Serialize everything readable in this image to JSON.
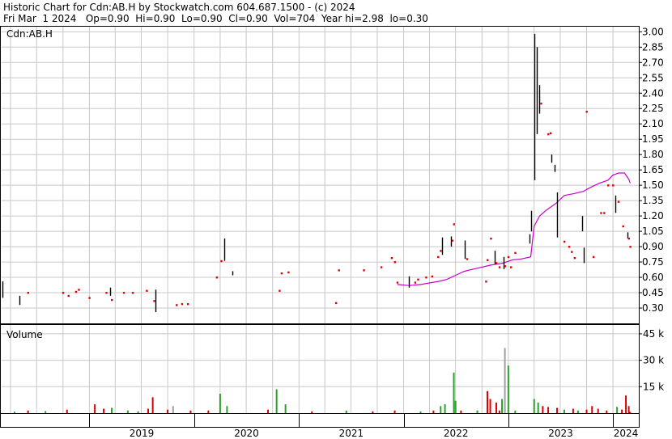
{
  "header": {
    "line1": "Historic Chart for Cdn:AB.H by Stockwatch.com 604.687.1500 - (c) 2024",
    "line2": "Fri Mar  1 2024   Op=0.90  Hi=0.90  Lo=0.90  Cl=0.90  Vol=704  Year hi=2.98  lo=0.30"
  },
  "colors": {
    "background": "#ffffff",
    "grid": "#c8c8c8",
    "price_bar": "#000000",
    "price_dot": "#e00000",
    "moving_average": "#cc00cc",
    "volume_up": "#2ca02c",
    "volume_down": "#dd0000",
    "volume_neutral": "#a0a0a0"
  },
  "chart_data": {
    "type": "line",
    "title": "Cdn:AB.H",
    "price_axis": {
      "ylim": [
        0.15,
        3.05
      ],
      "ticks": [
        "3.00",
        "2.85",
        "2.70",
        "2.55",
        "2.40",
        "2.25",
        "2.10",
        "1.95",
        "1.80",
        "1.65",
        "1.50",
        "1.35",
        "1.20",
        "1.05",
        "0.90",
        "0.75",
        "0.60",
        "0.45",
        "0.30"
      ]
    },
    "volume_axis": {
      "label": "Volume",
      "ylim": [
        0,
        50000
      ],
      "ticks": [
        {
          "v": 45000,
          "label": "45 k"
        },
        {
          "v": 30000,
          "label": "30 k"
        },
        {
          "v": 15000,
          "label": "15 k"
        }
      ]
    },
    "years": [
      "2019",
      "2020",
      "2021",
      "2022",
      "2023",
      "2024"
    ],
    "year_starts": [
      "2019-01-01",
      "2020-01-01",
      "2021-01-01",
      "2022-01-01",
      "2023-01-01",
      "2024-01-01"
    ],
    "x_range": [
      "2018-03-01",
      "2024-03-31"
    ],
    "grid": true,
    "price_bars": [
      {
        "date": "2018-03-05",
        "hi": 0.56,
        "lo": 0.4
      },
      {
        "date": "2018-05-01",
        "hi": 0.42,
        "lo": 0.33
      },
      {
        "date": "2019-03-15",
        "hi": 0.5,
        "lo": 0.42
      },
      {
        "date": "2019-08-20",
        "hi": 0.48,
        "lo": 0.26
      },
      {
        "date": "2020-04-15",
        "hi": 0.98,
        "lo": 0.76
      },
      {
        "date": "2020-05-15",
        "hi": 0.66,
        "lo": 0.62
      },
      {
        "date": "2022-01-20",
        "hi": 0.61,
        "lo": 0.5
      },
      {
        "date": "2022-05-15",
        "hi": 0.99,
        "lo": 0.82
      },
      {
        "date": "2022-06-15",
        "hi": 1.0,
        "lo": 0.9
      },
      {
        "date": "2022-08-01",
        "hi": 0.96,
        "lo": 0.78
      },
      {
        "date": "2022-11-15",
        "hi": 0.86,
        "lo": 0.73
      },
      {
        "date": "2022-12-15",
        "hi": 0.8,
        "lo": 0.68
      },
      {
        "date": "2023-03-15",
        "hi": 1.02,
        "lo": 0.93
      },
      {
        "date": "2023-03-22",
        "hi": 1.25,
        "lo": 1.05
      },
      {
        "date": "2023-04-01",
        "hi": 2.98,
        "lo": 1.55
      },
      {
        "date": "2023-04-10",
        "hi": 2.85,
        "lo": 2.0
      },
      {
        "date": "2023-04-20",
        "hi": 2.48,
        "lo": 2.2
      },
      {
        "date": "2023-06-01",
        "hi": 1.8,
        "lo": 1.72
      },
      {
        "date": "2023-06-10",
        "hi": 1.7,
        "lo": 1.63
      },
      {
        "date": "2023-06-20",
        "hi": 1.43,
        "lo": 0.99
      },
      {
        "date": "2023-09-15",
        "hi": 1.2,
        "lo": 1.05
      },
      {
        "date": "2023-09-20",
        "hi": 0.89,
        "lo": 0.74
      },
      {
        "date": "2024-01-10",
        "hi": 1.4,
        "lo": 1.23
      },
      {
        "date": "2024-02-20",
        "hi": 1.04,
        "lo": 0.98
      }
    ],
    "price_dots": [
      {
        "date": "2018-06-01",
        "v": 0.45
      },
      {
        "date": "2018-10-01",
        "v": 0.45
      },
      {
        "date": "2018-10-20",
        "v": 0.42
      },
      {
        "date": "2018-11-15",
        "v": 0.46
      },
      {
        "date": "2018-11-25",
        "v": 0.48
      },
      {
        "date": "2019-01-01",
        "v": 0.4
      },
      {
        "date": "2019-03-01",
        "v": 0.45
      },
      {
        "date": "2019-03-20",
        "v": 0.38
      },
      {
        "date": "2019-05-01",
        "v": 0.45
      },
      {
        "date": "2019-06-01",
        "v": 0.45
      },
      {
        "date": "2019-07-20",
        "v": 0.47
      },
      {
        "date": "2019-08-15",
        "v": 0.37
      },
      {
        "date": "2019-11-01",
        "v": 0.33
      },
      {
        "date": "2019-11-20",
        "v": 0.34
      },
      {
        "date": "2019-12-10",
        "v": 0.34
      },
      {
        "date": "2020-03-20",
        "v": 0.6
      },
      {
        "date": "2020-04-05",
        "v": 0.76
      },
      {
        "date": "2020-10-25",
        "v": 0.47
      },
      {
        "date": "2020-11-01",
        "v": 0.64
      },
      {
        "date": "2020-11-25",
        "v": 0.65
      },
      {
        "date": "2021-05-10",
        "v": 0.35
      },
      {
        "date": "2021-05-20",
        "v": 0.67
      },
      {
        "date": "2021-08-15",
        "v": 0.67
      },
      {
        "date": "2021-10-15",
        "v": 0.7
      },
      {
        "date": "2021-11-20",
        "v": 0.79
      },
      {
        "date": "2021-12-01",
        "v": 0.75
      },
      {
        "date": "2021-12-10",
        "v": 0.55
      },
      {
        "date": "2022-02-10",
        "v": 0.55
      },
      {
        "date": "2022-02-20",
        "v": 0.58
      },
      {
        "date": "2022-03-20",
        "v": 0.6
      },
      {
        "date": "2022-04-10",
        "v": 0.61
      },
      {
        "date": "2022-05-01",
        "v": 0.8
      },
      {
        "date": "2022-05-10",
        "v": 0.86
      },
      {
        "date": "2022-06-20",
        "v": 0.96
      },
      {
        "date": "2022-06-25",
        "v": 1.12
      },
      {
        "date": "2022-08-10",
        "v": 0.78
      },
      {
        "date": "2022-10-15",
        "v": 0.56
      },
      {
        "date": "2022-10-20",
        "v": 0.77
      },
      {
        "date": "2022-11-01",
        "v": 0.98
      },
      {
        "date": "2022-11-20",
        "v": 0.74
      },
      {
        "date": "2022-12-01",
        "v": 0.7
      },
      {
        "date": "2022-12-20",
        "v": 0.71
      },
      {
        "date": "2023-01-01",
        "v": 0.8
      },
      {
        "date": "2023-01-10",
        "v": 0.7
      },
      {
        "date": "2023-01-25",
        "v": 0.84
      },
      {
        "date": "2023-04-25",
        "v": 2.3
      },
      {
        "date": "2023-05-20",
        "v": 2.0
      },
      {
        "date": "2023-05-28",
        "v": 2.01
      },
      {
        "date": "2023-07-15",
        "v": 0.95
      },
      {
        "date": "2023-08-01",
        "v": 0.9
      },
      {
        "date": "2023-08-10",
        "v": 0.85
      },
      {
        "date": "2023-08-20",
        "v": 0.79
      },
      {
        "date": "2023-10-01",
        "v": 2.22
      },
      {
        "date": "2023-10-25",
        "v": 0.8
      },
      {
        "date": "2023-11-20",
        "v": 1.23
      },
      {
        "date": "2023-12-01",
        "v": 1.23
      },
      {
        "date": "2023-12-15",
        "v": 1.5
      },
      {
        "date": "2024-01-01",
        "v": 1.5
      },
      {
        "date": "2024-01-20",
        "v": 1.34
      },
      {
        "date": "2024-02-05",
        "v": 1.1
      },
      {
        "date": "2024-02-25",
        "v": 0.98
      },
      {
        "date": "2024-03-01",
        "v": 0.9
      }
    ],
    "moving_average": [
      {
        "date": "2021-12-10",
        "v": 0.53
      },
      {
        "date": "2022-01-20",
        "v": 0.52
      },
      {
        "date": "2022-03-01",
        "v": 0.53
      },
      {
        "date": "2022-05-01",
        "v": 0.56
      },
      {
        "date": "2022-06-01",
        "v": 0.58
      },
      {
        "date": "2022-07-01",
        "v": 0.62
      },
      {
        "date": "2022-08-01",
        "v": 0.66
      },
      {
        "date": "2022-09-15",
        "v": 0.69
      },
      {
        "date": "2022-11-01",
        "v": 0.72
      },
      {
        "date": "2022-12-15",
        "v": 0.74
      },
      {
        "date": "2023-01-15",
        "v": 0.77
      },
      {
        "date": "2023-02-15",
        "v": 0.78
      },
      {
        "date": "2023-03-20",
        "v": 0.8
      },
      {
        "date": "2023-04-01",
        "v": 1.1
      },
      {
        "date": "2023-04-20",
        "v": 1.2
      },
      {
        "date": "2023-05-15",
        "v": 1.26
      },
      {
        "date": "2023-06-15",
        "v": 1.32
      },
      {
        "date": "2023-07-15",
        "v": 1.4
      },
      {
        "date": "2023-08-20",
        "v": 1.42
      },
      {
        "date": "2023-09-20",
        "v": 1.44
      },
      {
        "date": "2023-10-15",
        "v": 1.48
      },
      {
        "date": "2023-11-15",
        "v": 1.52
      },
      {
        "date": "2023-12-15",
        "v": 1.55
      },
      {
        "date": "2024-01-01",
        "v": 1.6
      },
      {
        "date": "2024-01-20",
        "v": 1.62
      },
      {
        "date": "2024-02-10",
        "v": 1.62
      },
      {
        "date": "2024-02-25",
        "v": 1.56
      },
      {
        "date": "2024-03-01",
        "v": 1.52
      }
    ],
    "volume_bars": [
      {
        "date": "2018-04-15",
        "v": 800,
        "c": "up"
      },
      {
        "date": "2018-06-01",
        "v": 1500,
        "c": "down"
      },
      {
        "date": "2018-08-01",
        "v": 1200,
        "c": "up"
      },
      {
        "date": "2018-10-15",
        "v": 2000,
        "c": "down"
      },
      {
        "date": "2019-01-20",
        "v": 5000,
        "c": "down"
      },
      {
        "date": "2019-02-20",
        "v": 2500,
        "c": "down"
      },
      {
        "date": "2019-03-20",
        "v": 3000,
        "c": "up"
      },
      {
        "date": "2019-05-15",
        "v": 1500,
        "c": "up"
      },
      {
        "date": "2019-06-20",
        "v": 1000,
        "c": "up"
      },
      {
        "date": "2019-07-25",
        "v": 2500,
        "c": "down"
      },
      {
        "date": "2019-08-10",
        "v": 9000,
        "c": "down"
      },
      {
        "date": "2019-10-01",
        "v": 2000,
        "c": "down"
      },
      {
        "date": "2019-10-20",
        "v": 4000,
        "c": "neutral"
      },
      {
        "date": "2019-12-20",
        "v": 1500,
        "c": "down"
      },
      {
        "date": "2020-02-20",
        "v": 1500,
        "c": "down"
      },
      {
        "date": "2020-04-01",
        "v": 11000,
        "c": "up"
      },
      {
        "date": "2020-04-25",
        "v": 4000,
        "c": "up"
      },
      {
        "date": "2020-09-15",
        "v": 2000,
        "c": "down"
      },
      {
        "date": "2020-10-15",
        "v": 13500,
        "c": "up"
      },
      {
        "date": "2020-11-15",
        "v": 5000,
        "c": "up"
      },
      {
        "date": "2021-02-15",
        "v": 1000,
        "c": "down"
      },
      {
        "date": "2021-06-15",
        "v": 1500,
        "c": "up"
      },
      {
        "date": "2021-09-15",
        "v": 1000,
        "c": "down"
      },
      {
        "date": "2021-12-01",
        "v": 1500,
        "c": "down"
      },
      {
        "date": "2022-03-01",
        "v": 1000,
        "c": "up"
      },
      {
        "date": "2022-04-15",
        "v": 1500,
        "c": "down"
      },
      {
        "date": "2022-05-10",
        "v": 4000,
        "c": "up"
      },
      {
        "date": "2022-05-25",
        "v": 5000,
        "c": "up"
      },
      {
        "date": "2022-06-25",
        "v": 23000,
        "c": "up"
      },
      {
        "date": "2022-07-01",
        "v": 7000,
        "c": "up"
      },
      {
        "date": "2022-07-20",
        "v": 1500,
        "c": "down"
      },
      {
        "date": "2022-09-15",
        "v": 1500,
        "c": "up"
      },
      {
        "date": "2022-10-20",
        "v": 12500,
        "c": "down"
      },
      {
        "date": "2022-10-30",
        "v": 8000,
        "c": "down"
      },
      {
        "date": "2022-11-20",
        "v": 6000,
        "c": "down"
      },
      {
        "date": "2022-12-01",
        "v": 1500,
        "c": "down"
      },
      {
        "date": "2022-12-10",
        "v": 8000,
        "c": "up"
      },
      {
        "date": "2022-12-20",
        "v": 37000,
        "c": "neutral"
      },
      {
        "date": "2023-01-01",
        "v": 27000,
        "c": "up"
      },
      {
        "date": "2023-01-25",
        "v": 1500,
        "c": "up"
      },
      {
        "date": "2023-04-01",
        "v": 8000,
        "c": "up"
      },
      {
        "date": "2023-04-15",
        "v": 6000,
        "c": "up"
      },
      {
        "date": "2023-05-01",
        "v": 4000,
        "c": "down"
      },
      {
        "date": "2023-05-20",
        "v": 3500,
        "c": "down"
      },
      {
        "date": "2023-06-20",
        "v": 3000,
        "c": "down"
      },
      {
        "date": "2023-07-15",
        "v": 2000,
        "c": "up"
      },
      {
        "date": "2023-08-15",
        "v": 2500,
        "c": "down"
      },
      {
        "date": "2023-09-01",
        "v": 1500,
        "c": "up"
      },
      {
        "date": "2023-10-01",
        "v": 2000,
        "c": "down"
      },
      {
        "date": "2023-10-20",
        "v": 4000,
        "c": "down"
      },
      {
        "date": "2023-11-10",
        "v": 2500,
        "c": "down"
      },
      {
        "date": "2023-12-10",
        "v": 1500,
        "c": "down"
      },
      {
        "date": "2024-01-15",
        "v": 3500,
        "c": "up"
      },
      {
        "date": "2024-02-01",
        "v": 2000,
        "c": "down"
      },
      {
        "date": "2024-02-15",
        "v": 10000,
        "c": "down"
      },
      {
        "date": "2024-02-25",
        "v": 4000,
        "c": "down"
      },
      {
        "date": "2024-03-01",
        "v": 700,
        "c": "down"
      }
    ]
  }
}
